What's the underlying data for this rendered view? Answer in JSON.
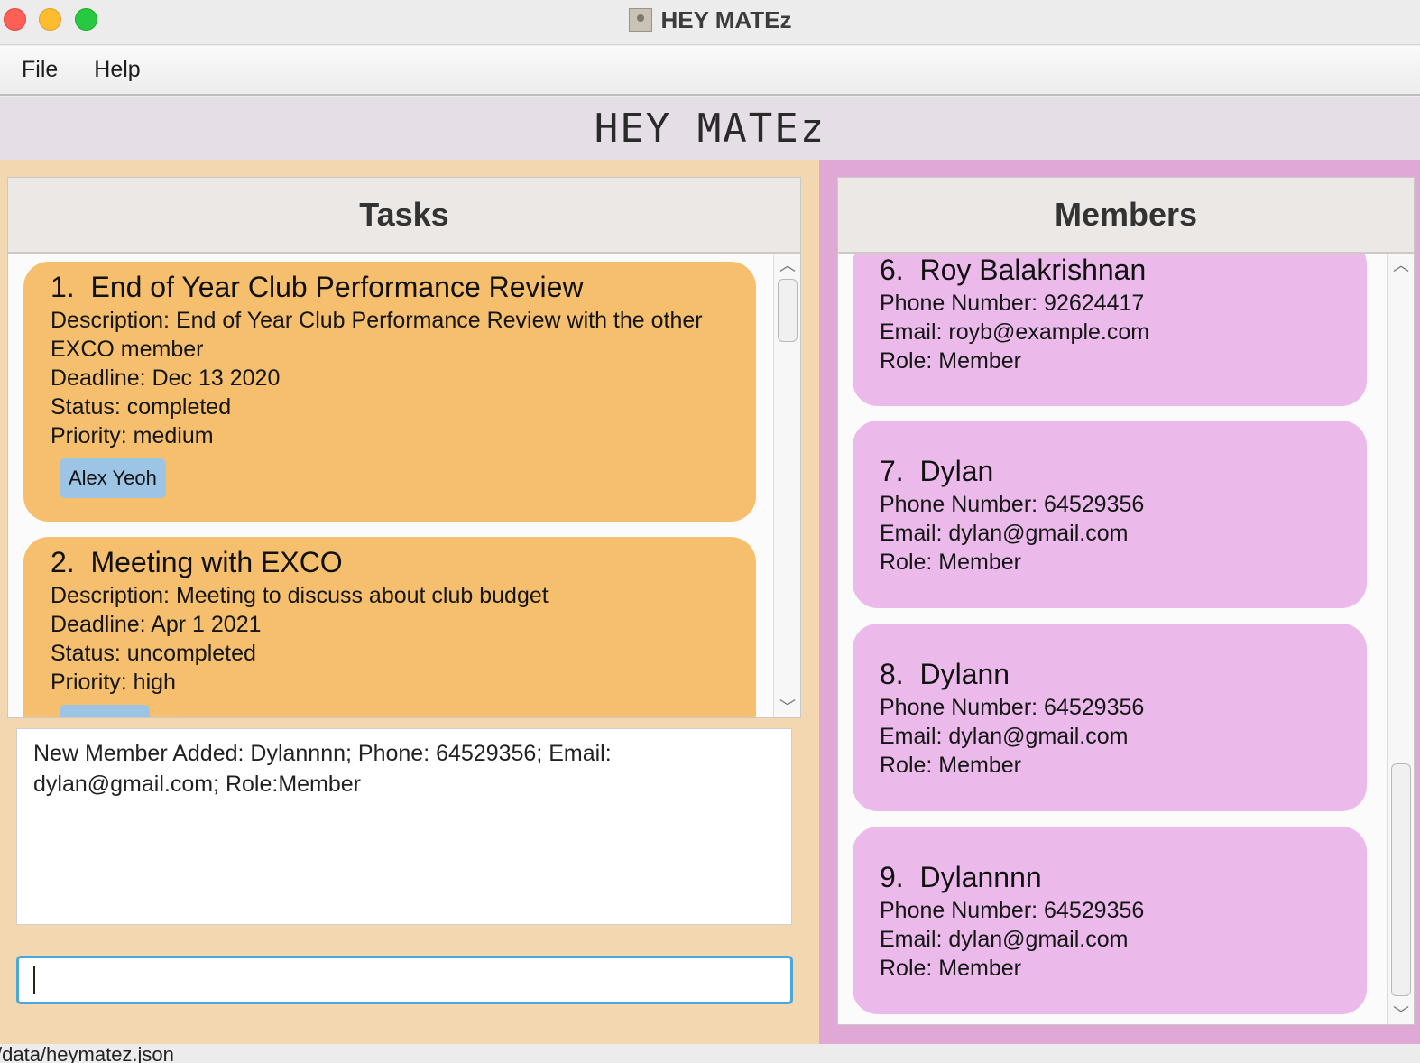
{
  "window": {
    "title": "HEY MATEz"
  },
  "menu": {
    "file": "File",
    "help": "Help"
  },
  "app_header": {
    "title": "HEY MATEz"
  },
  "tasks": {
    "header": "Tasks",
    "items": [
      {
        "index": "1.",
        "title": "End of Year Club Performance Review",
        "description_line1": "Description: End of Year Club Performance Review with the other",
        "description_line2": "EXCO member",
        "deadline": "Deadline: Dec 13 2020",
        "status": "Status: completed",
        "priority": "Priority: medium",
        "assignee": "Alex Yeoh"
      },
      {
        "index": "2.",
        "title": "Meeting with EXCO",
        "description_line1": "Description: Meeting to discuss about club budget",
        "deadline": "Deadline: Apr 1 2021",
        "status": "Status: uncompleted",
        "priority": "Priority: high"
      }
    ]
  },
  "result": {
    "line1": "New Member Added: Dylannnn; Phone: 64529356; Email:",
    "line2": "dylan@gmail.com; Role:Member"
  },
  "command": {
    "value": ""
  },
  "members": {
    "header": "Members",
    "items": [
      {
        "index": "6.",
        "name": "Roy Balakrishnan",
        "phone": "Phone Number: 92624417",
        "email": "Email: royb@example.com",
        "role": "Role: Member"
      },
      {
        "index": "7.",
        "name": "Dylan",
        "phone": "Phone Number: 64529356",
        "email": "Email: dylan@gmail.com",
        "role": "Role: Member"
      },
      {
        "index": "8.",
        "name": "Dylann",
        "phone": "Phone Number: 64529356",
        "email": "Email: dylan@gmail.com",
        "role": "Role: Member"
      },
      {
        "index": "9.",
        "name": "Dylannnn",
        "phone": "Phone Number: 64529356",
        "email": "Email: dylan@gmail.com",
        "role": "Role: Member"
      }
    ]
  },
  "statusbar": {
    "path": "/data/heymatez.json"
  }
}
